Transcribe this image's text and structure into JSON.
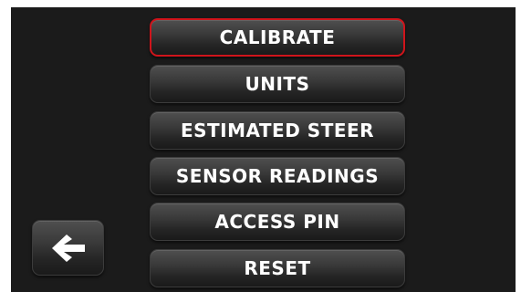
{
  "menu": {
    "items": [
      {
        "label": "CALIBRATE",
        "selected": true
      },
      {
        "label": "UNITS",
        "selected": false
      },
      {
        "label": "ESTIMATED STEER",
        "selected": false
      },
      {
        "label": "SENSOR READINGS",
        "selected": false
      },
      {
        "label": "ACCESS PIN",
        "selected": false
      },
      {
        "label": "RESET",
        "selected": false
      }
    ]
  },
  "back_button": {
    "icon": "arrow-left-icon"
  },
  "colors": {
    "background": "#1b1b1b",
    "selection_border": "#d0141b",
    "text": "#ffffff"
  }
}
